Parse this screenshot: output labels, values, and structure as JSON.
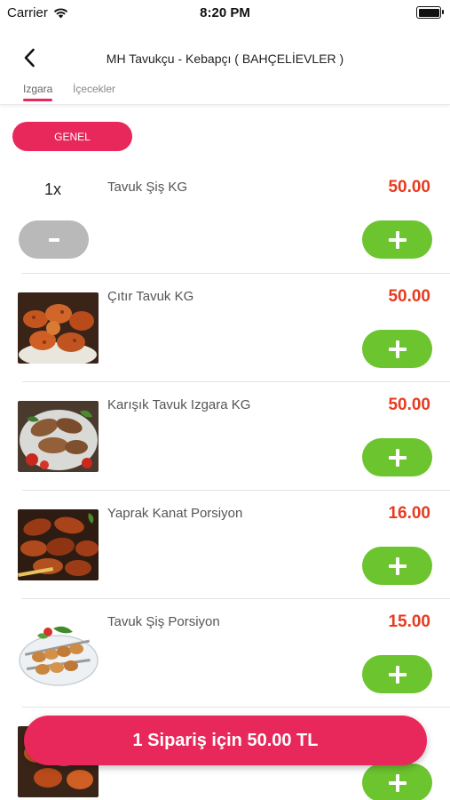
{
  "status_bar": {
    "carrier": "Carrier",
    "time": "8:20 PM",
    "battery_level": 1.0
  },
  "nav": {
    "title": "MH Tavukçu - Kebapçı ( BAHÇELİEVLER )",
    "back_icon": "chevron-left-icon"
  },
  "tabs": [
    {
      "label": "Izgara",
      "active": true
    },
    {
      "label": "İçecekler",
      "active": false
    }
  ],
  "category": {
    "label": "GENEL"
  },
  "products": [
    {
      "quantity": "1x",
      "name": "Tavuk Şiş KG",
      "price": "50.00",
      "remove_label": "-",
      "image": "none"
    },
    {
      "name": "Çıtır Tavuk KG",
      "price": "50.00",
      "image": "fried-chicken"
    },
    {
      "name": "Karışık Tavuk Izgara KG",
      "price": "50.00",
      "image": "grilled-chicken-mix"
    },
    {
      "name": "Yaprak Kanat Porsiyon",
      "price": "16.00",
      "image": "chicken-wings"
    },
    {
      "name": "Tavuk Şiş Porsiyon",
      "price": "15.00",
      "image": "chicken-skewers"
    },
    {
      "name": "",
      "price": "",
      "image": "fried-chicken"
    }
  ],
  "order_bar": {
    "label": "1 Sipariş için 50.00 TL"
  },
  "colors": {
    "accent": "#e8275a",
    "add_button": "#6cc42f",
    "remove_button": "#b9b9b9",
    "price": "#e83a1e"
  }
}
